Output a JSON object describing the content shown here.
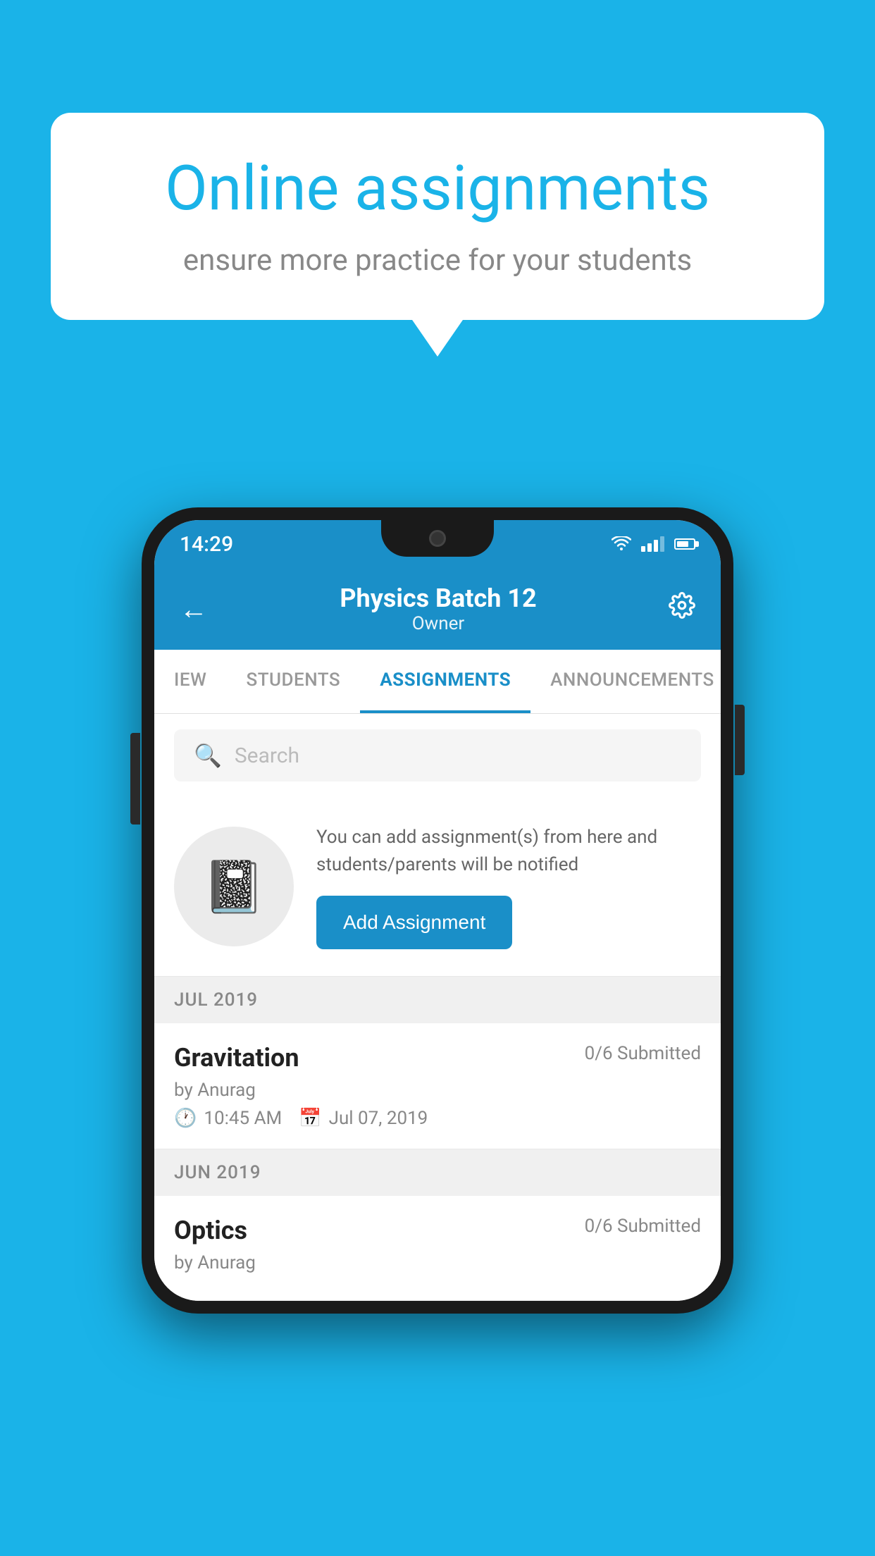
{
  "background": {
    "color": "#1ab3e8"
  },
  "speech_bubble": {
    "title": "Online assignments",
    "subtitle": "ensure more practice for your students"
  },
  "phone": {
    "status_bar": {
      "time": "14:29",
      "icons": [
        "wifi",
        "signal",
        "battery"
      ]
    },
    "header": {
      "title": "Physics Batch 12",
      "subtitle": "Owner",
      "back_label": "←",
      "settings_label": "⚙"
    },
    "tabs": [
      {
        "label": "IEW",
        "active": false
      },
      {
        "label": "STUDENTS",
        "active": false
      },
      {
        "label": "ASSIGNMENTS",
        "active": true
      },
      {
        "label": "ANNOUNCEMENTS",
        "active": false
      }
    ],
    "search": {
      "placeholder": "Search"
    },
    "add_prompt": {
      "description": "You can add assignment(s) from here and students/parents will be notified",
      "button_label": "Add Assignment"
    },
    "sections": [
      {
        "month": "JUL 2019",
        "assignments": [
          {
            "title": "Gravitation",
            "status": "0/6 Submitted",
            "by": "by Anurag",
            "time": "10:45 AM",
            "date": "Jul 07, 2019"
          }
        ]
      },
      {
        "month": "JUN 2019",
        "assignments": [
          {
            "title": "Optics",
            "status": "0/6 Submitted",
            "by": "by Anurag",
            "time": "",
            "date": ""
          }
        ]
      }
    ]
  }
}
